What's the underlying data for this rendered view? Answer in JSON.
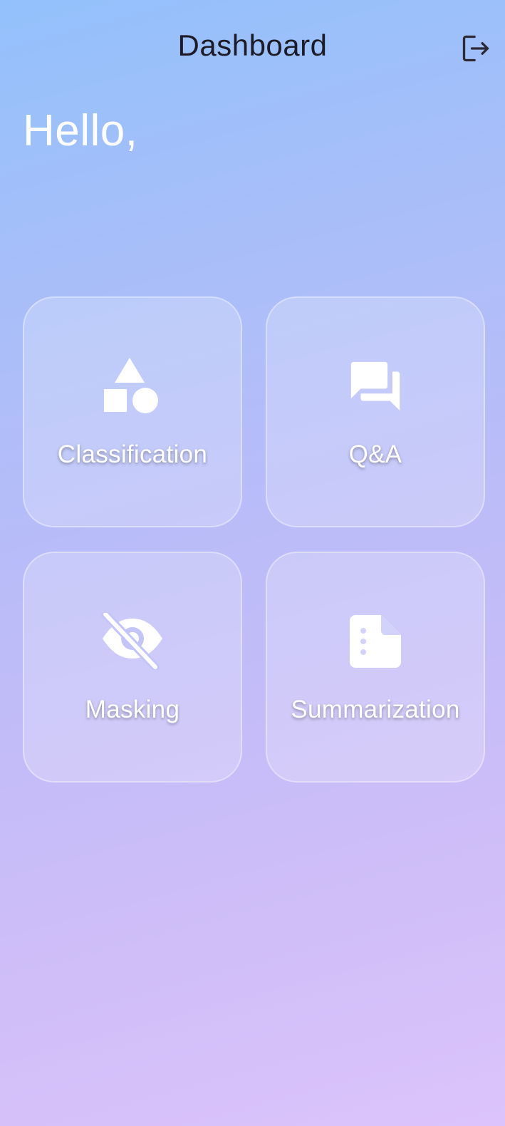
{
  "header": {
    "title": "Dashboard",
    "logout_icon": "logout-icon"
  },
  "greeting": "Hello,",
  "cards": [
    {
      "label": "Classification",
      "icon": "shapes-icon"
    },
    {
      "label": "Q&A",
      "icon": "forum-icon"
    },
    {
      "label": "Masking",
      "icon": "visibility-off-icon"
    },
    {
      "label": "Summarization",
      "icon": "summarize-icon"
    }
  ],
  "colors": {
    "gradient_top": "#93c1fb",
    "gradient_bottom": "#dcc3fb",
    "title_text": "#1c1b26",
    "card_text": "#ffffff"
  }
}
